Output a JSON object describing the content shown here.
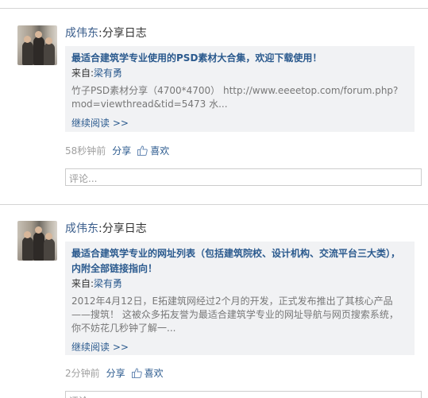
{
  "posts": [
    {
      "author": "成伟东",
      "action": ":分享日志",
      "title": "最适合建筑学专业使用的PSD素材大合集，欢迎下载使用！",
      "source_prefix": "来自:",
      "source_name": "梁有勇",
      "excerpt": "竹子PSD素材分享（4700*4700） http://www.eeeetop.com/forum.php?mod=viewthread&tid=5473 水...",
      "read_more": "继续阅读 >>",
      "time": "58秒钟前",
      "share_label": "分享",
      "like_label": "喜欢",
      "comment_placeholder": "评论..."
    },
    {
      "author": "成伟东",
      "action": ":分享日志",
      "title": "最适合建筑学专业的网址列表（包括建筑院校、设计机构、交流平台三大类），内附全部链接指向！",
      "source_prefix": "来自:",
      "source_name": "梁有勇",
      "excerpt": "2012年4月12日，E拓建筑网经过2个月的开发，正式发布推出了其核心产品——搜筑！ 这被众多拓友誉为最适合建筑学专业的网址导航与网页搜索系统，你不妨花几秒钟了解一...",
      "read_more": "继续阅读 >>",
      "time": "2分钟前",
      "share_label": "分享",
      "like_label": "喜欢",
      "comment_placeholder": "评论..."
    }
  ],
  "icons": {
    "like": "thumbs-up-icon"
  },
  "colors": {
    "link": "#2b5a8e",
    "author": "#3b5e8c",
    "card_bg": "#f1f2f4",
    "muted": "#a0a0a0"
  }
}
